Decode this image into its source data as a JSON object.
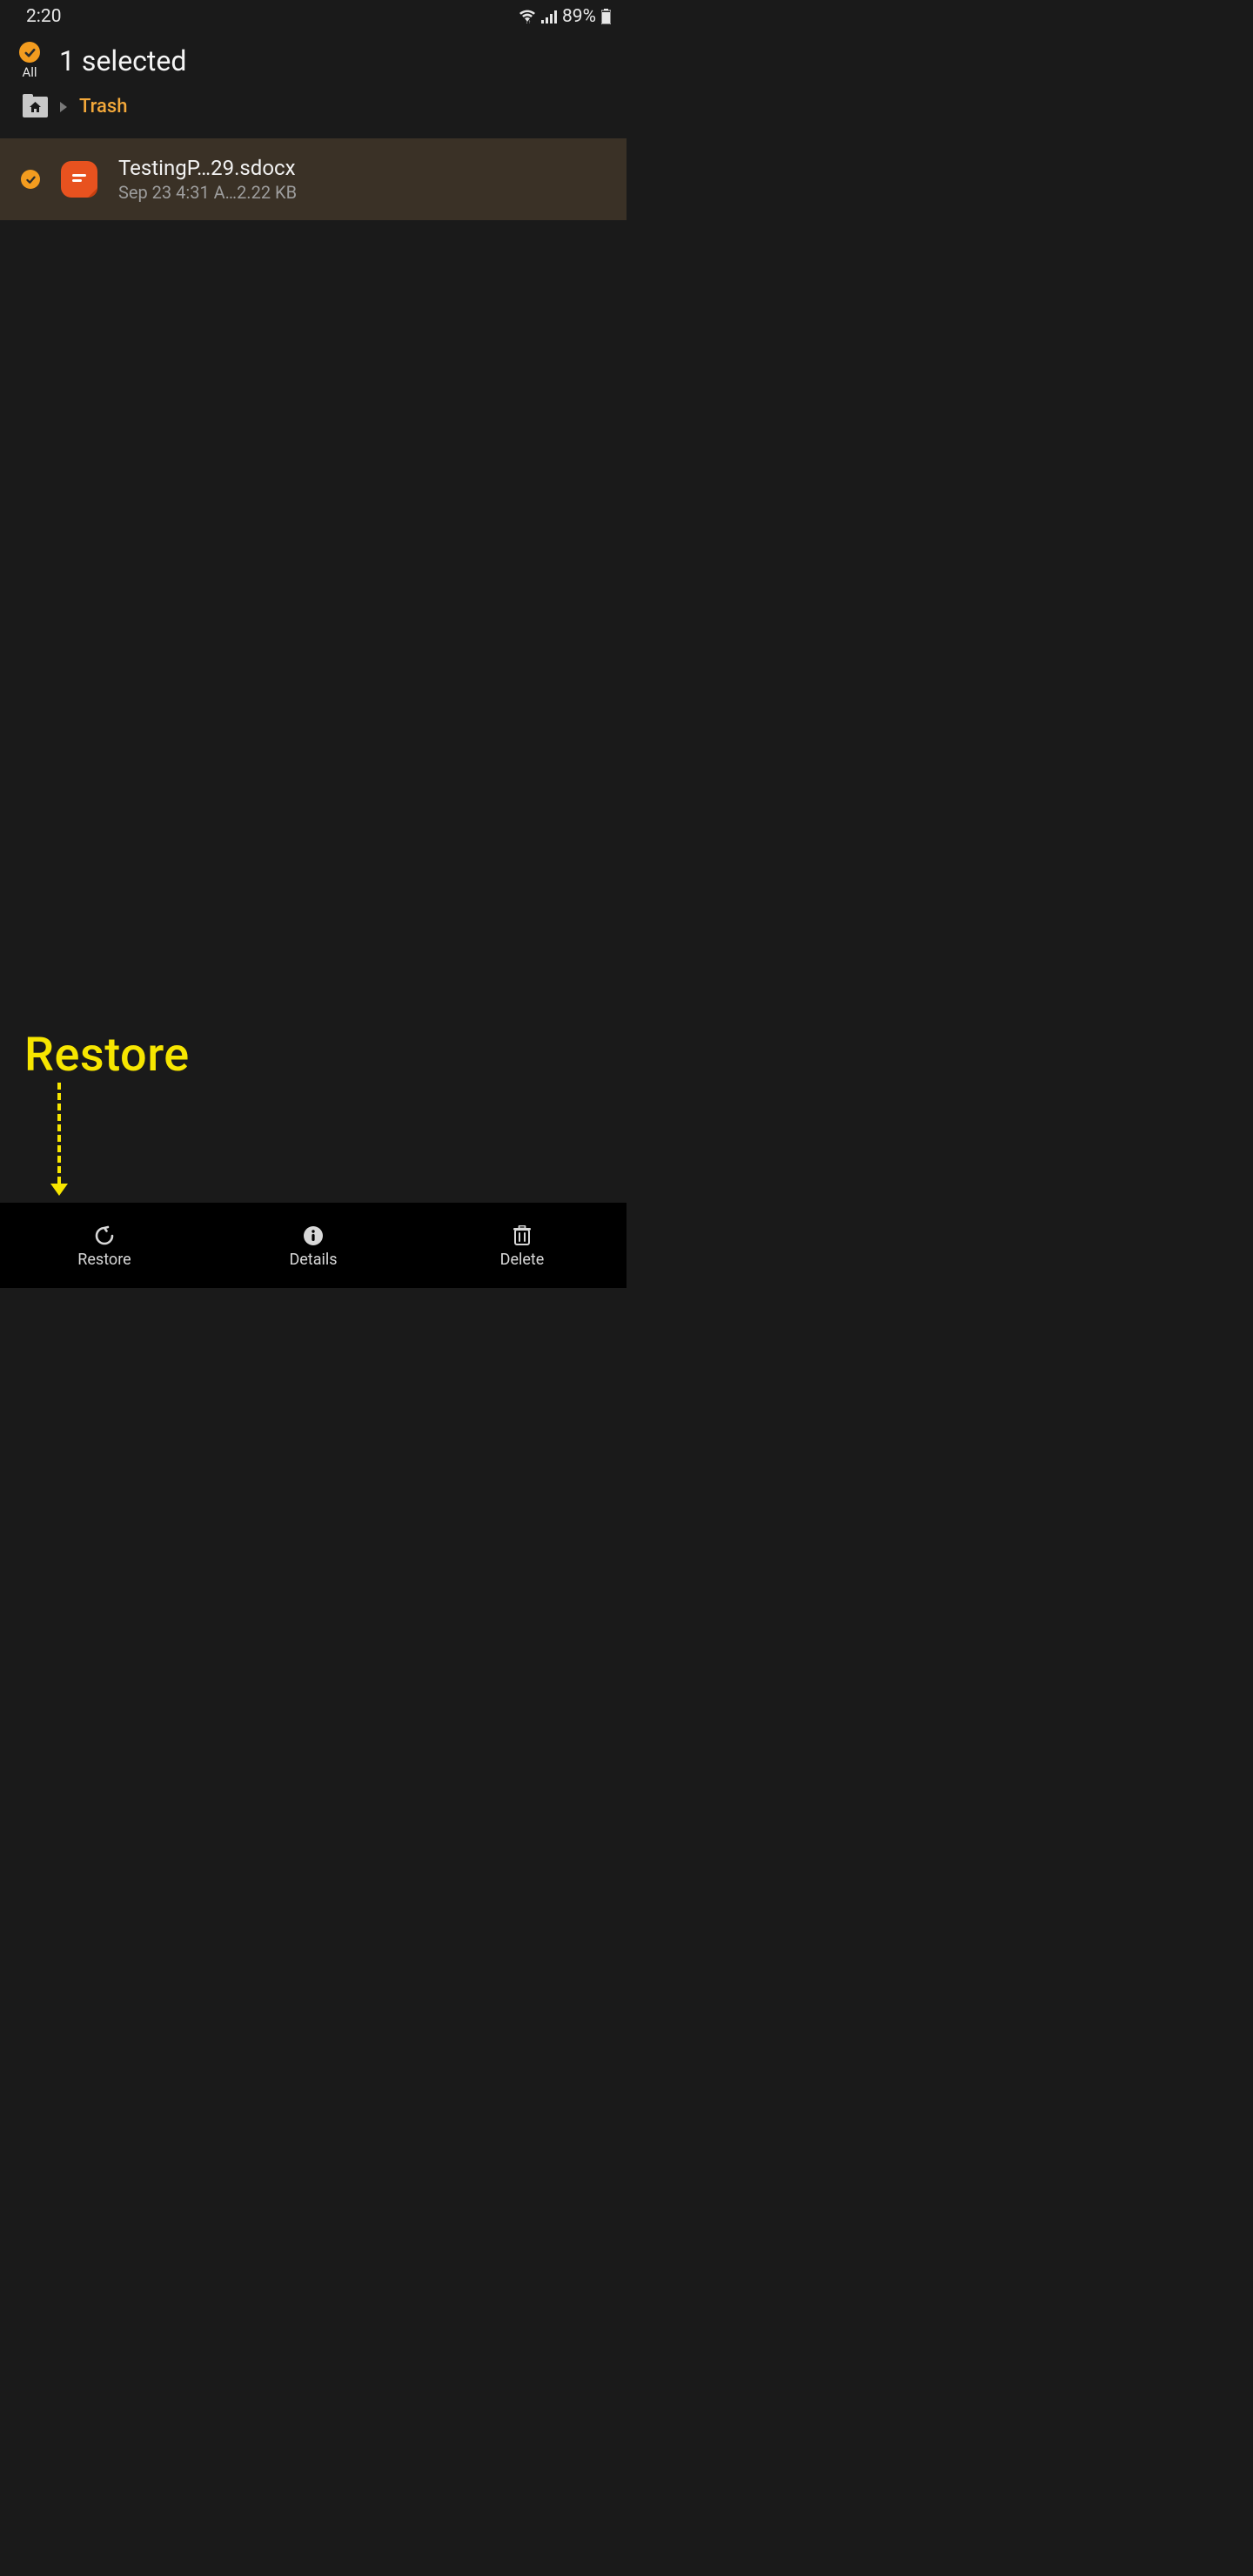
{
  "status": {
    "time": "2:20",
    "battery": "89%"
  },
  "header": {
    "all_label": "All",
    "selected_text": "1 selected"
  },
  "breadcrumb": {
    "current": "Trash"
  },
  "files": [
    {
      "name": "TestingP…29.sdocx",
      "meta": "Sep 23 4:31 A…2.22 KB",
      "selected": true
    }
  ],
  "annotation": {
    "label": "Restore"
  },
  "bottom": {
    "restore": "Restore",
    "details": "Details",
    "delete": "Delete"
  }
}
